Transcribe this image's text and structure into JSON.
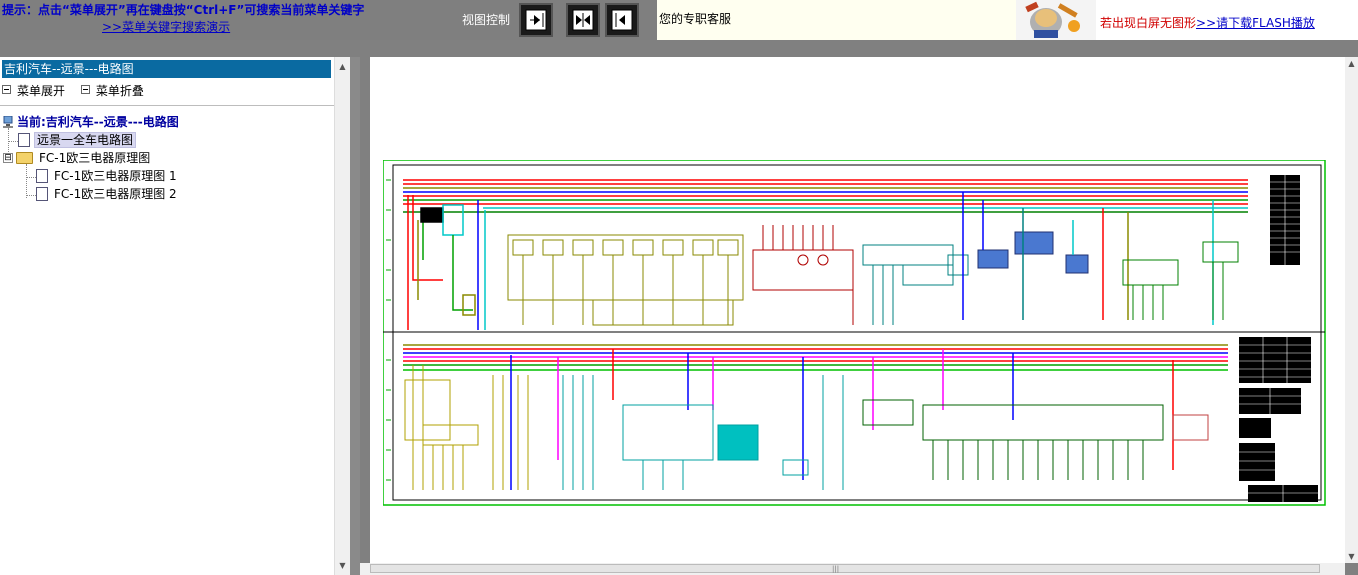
{
  "toolbar": {
    "hint": "提示：点击“菜单展开”再在键盘按“Ctrl+F”可搜索当前菜单关键字",
    "demo_link": ">>菜单关键字搜索演示",
    "view_label": "视图控制",
    "service": "您的专职客服",
    "flash_msg": "若出现白屏无图形",
    "flash_link": ">>请下载FLASH播放"
  },
  "left_panel": {
    "title": "吉利汽车--远景---电路图",
    "expand_label": "菜单展开",
    "collapse_label": "菜单折叠",
    "tree": {
      "current": "当前:吉利汽车--远景---电路图",
      "items": [
        {
          "label": "远景一全车电路图"
        },
        {
          "label": "FC-1欧三电器原理图",
          "expander": "⊟"
        },
        {
          "label": "FC-1欧三电器原理图 1"
        },
        {
          "label": "FC-1欧三电器原理图 2"
        }
      ]
    }
  },
  "colors": {
    "panel_title_bg": "#0a6aa1",
    "hint_text": "#0000c8",
    "warning_text": "#d00000",
    "diagram_border": "#00c000",
    "wire_red": "#ff0000",
    "wire_blue": "#0000ff",
    "wire_magenta": "#ff00ff",
    "wire_cyan": "#00c8c8",
    "wire_olive": "#8a8a00",
    "wire_green": "#008000"
  }
}
